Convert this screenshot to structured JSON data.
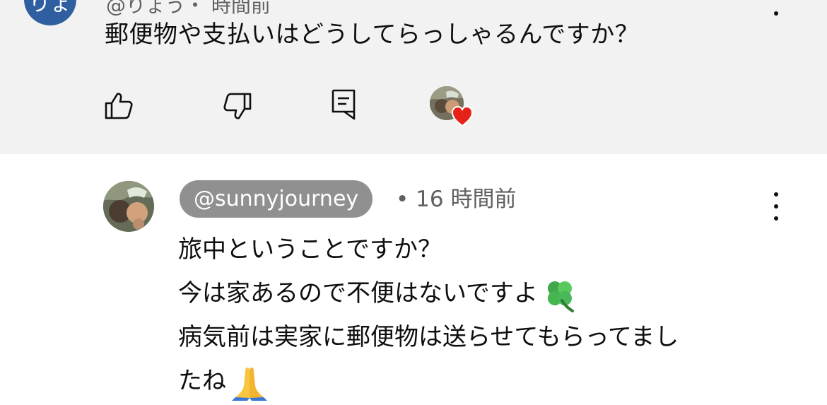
{
  "top_comment": {
    "avatar_text": "りょ",
    "header_fragment": "@りょう・ 時間前",
    "text": "郵便物や支払いはどうしてらっしゃるんですか？",
    "actions": {
      "like": "like-icon",
      "dislike": "dislike-icon",
      "reply": "reply-icon",
      "creator_heart": "creator-heart-icon"
    }
  },
  "reply": {
    "author": "@sunnyjourney",
    "separator": "•",
    "time": "16 時間前",
    "lines": [
      "旅中ということですか？",
      "今は家あるので不便はないですよ",
      "病気前は実家に郵便物は送らせてもらってまし",
      "たね"
    ],
    "emojis": {
      "line2": "four-leaf-clover-icon",
      "line4": "folded-hands-icon"
    }
  },
  "colors": {
    "top_background": "#f2f2f2",
    "author_pill": "#909090",
    "heart": "#e62117",
    "top_avatar": "#2f5fa0"
  }
}
